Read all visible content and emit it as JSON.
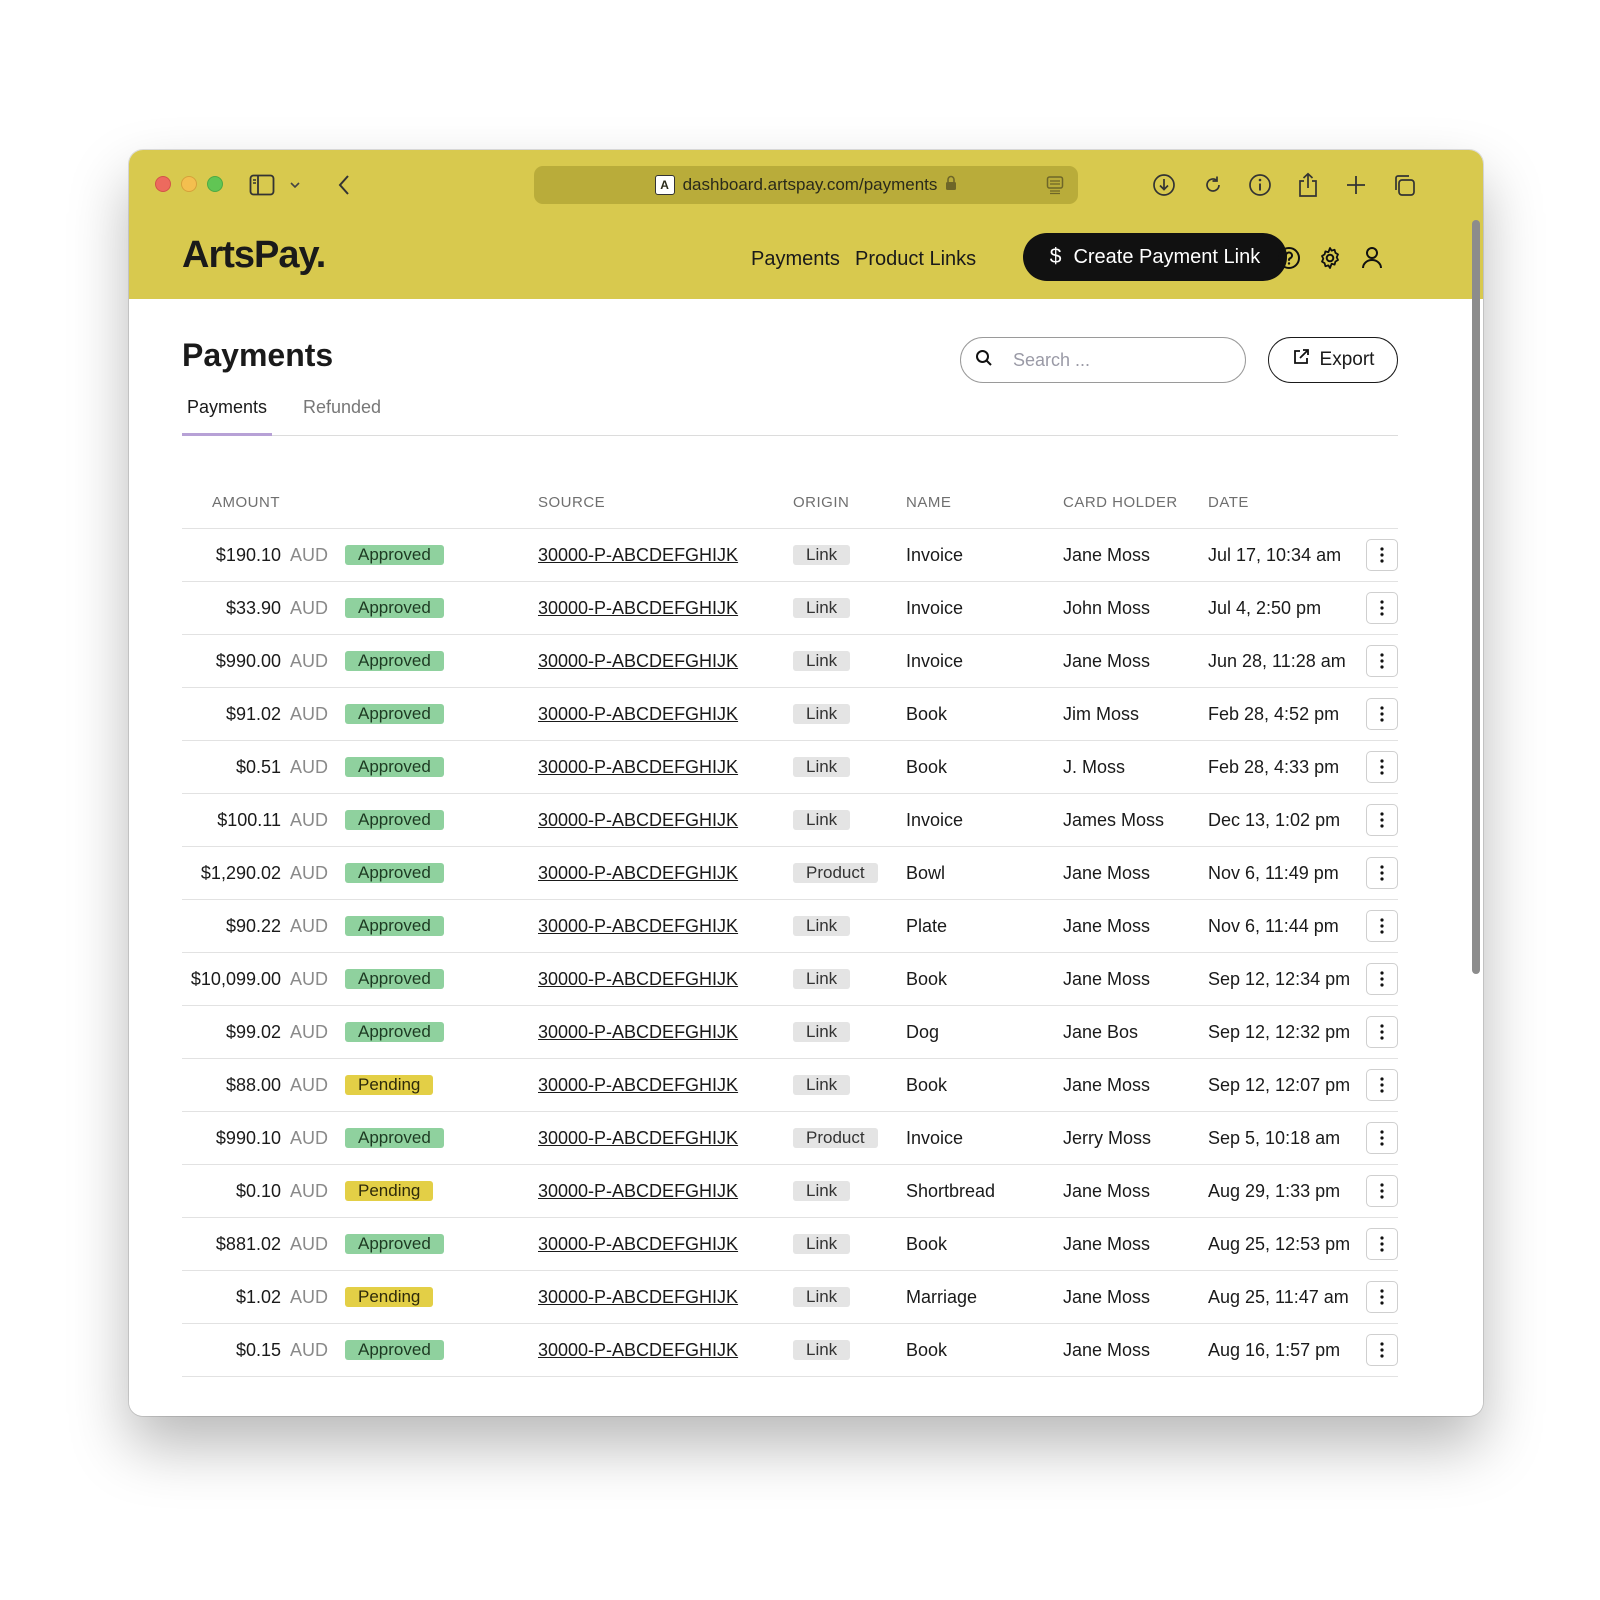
{
  "browser": {
    "url": "dashboard.artspay.com/payments",
    "favicon_letter": "A",
    "chrome_color": "#d8c94e"
  },
  "header": {
    "logo": "ArtsPay.",
    "nav": [
      "Payments",
      "Product Links"
    ],
    "create_button": "Create Payment Link",
    "icons": [
      "help-icon",
      "settings-icon",
      "user-icon"
    ]
  },
  "page": {
    "title": "Payments",
    "search_placeholder": "Search ...",
    "export_label": "Export",
    "tabs": [
      "Payments",
      "Refunded"
    ],
    "active_tab": "Payments"
  },
  "table": {
    "columns": [
      "AMOUNT",
      "SOURCE",
      "ORIGIN",
      "NAME",
      "CARD HOLDER",
      "DATE"
    ],
    "rows": [
      {
        "amount": "$190.10",
        "currency": "AUD",
        "status": "Approved",
        "source": "30000-P-ABCDEFGHIJK",
        "origin": "Link",
        "name": "Invoice",
        "holder": "Jane Moss",
        "date": "Jul 17, 10:34 am"
      },
      {
        "amount": "$33.90",
        "currency": "AUD",
        "status": "Approved",
        "source": "30000-P-ABCDEFGHIJK",
        "origin": "Link",
        "name": "Invoice",
        "holder": "John Moss",
        "date": "Jul 4, 2:50 pm"
      },
      {
        "amount": "$990.00",
        "currency": "AUD",
        "status": "Approved",
        "source": "30000-P-ABCDEFGHIJK",
        "origin": "Link",
        "name": "Invoice",
        "holder": "Jane Moss",
        "date": "Jun 28, 11:28 am"
      },
      {
        "amount": "$91.02",
        "currency": "AUD",
        "status": "Approved",
        "source": "30000-P-ABCDEFGHIJK",
        "origin": "Link",
        "name": "Book",
        "holder": "Jim Moss",
        "date": "Feb 28, 4:52 pm"
      },
      {
        "amount": "$0.51",
        "currency": "AUD",
        "status": "Approved",
        "source": "30000-P-ABCDEFGHIJK",
        "origin": "Link",
        "name": "Book",
        "holder": "J. Moss",
        "date": "Feb 28, 4:33 pm"
      },
      {
        "amount": "$100.11",
        "currency": "AUD",
        "status": "Approved",
        "source": "30000-P-ABCDEFGHIJK",
        "origin": "Link",
        "name": "Invoice",
        "holder": "James Moss",
        "date": "Dec 13, 1:02 pm"
      },
      {
        "amount": "$1,290.02",
        "currency": "AUD",
        "status": "Approved",
        "source": "30000-P-ABCDEFGHIJK",
        "origin": "Product",
        "name": "Bowl",
        "holder": "Jane Moss",
        "date": "Nov 6, 11:49 pm"
      },
      {
        "amount": "$90.22",
        "currency": "AUD",
        "status": "Approved",
        "source": "30000-P-ABCDEFGHIJK",
        "origin": "Link",
        "name": "Plate",
        "holder": "Jane Moss",
        "date": "Nov 6, 11:44 pm"
      },
      {
        "amount": "$10,099.00",
        "currency": "AUD",
        "status": "Approved",
        "source": "30000-P-ABCDEFGHIJK",
        "origin": "Link",
        "name": "Book",
        "holder": "Jane Moss",
        "date": "Sep 12, 12:34 pm"
      },
      {
        "amount": "$99.02",
        "currency": "AUD",
        "status": "Approved",
        "source": "30000-P-ABCDEFGHIJK",
        "origin": "Link",
        "name": "Dog",
        "holder": "Jane Bos",
        "date": "Sep 12, 12:32 pm"
      },
      {
        "amount": "$88.00",
        "currency": "AUD",
        "status": "Pending",
        "source": "30000-P-ABCDEFGHIJK",
        "origin": "Link",
        "name": "Book",
        "holder": "Jane Moss",
        "date": "Sep 12, 12:07 pm"
      },
      {
        "amount": "$990.10",
        "currency": "AUD",
        "status": "Approved",
        "source": "30000-P-ABCDEFGHIJK",
        "origin": "Product",
        "name": "Invoice",
        "holder": "Jerry Moss",
        "date": "Sep 5, 10:18 am"
      },
      {
        "amount": "$0.10",
        "currency": "AUD",
        "status": "Pending",
        "source": "30000-P-ABCDEFGHIJK",
        "origin": "Link",
        "name": "Shortbread",
        "holder": "Jane Moss",
        "date": "Aug 29, 1:33 pm"
      },
      {
        "amount": "$881.02",
        "currency": "AUD",
        "status": "Approved",
        "source": "30000-P-ABCDEFGHIJK",
        "origin": "Link",
        "name": "Book",
        "holder": "Jane Moss",
        "date": "Aug 25, 12:53 pm"
      },
      {
        "amount": "$1.02",
        "currency": "AUD",
        "status": "Pending",
        "source": "30000-P-ABCDEFGHIJK",
        "origin": "Link",
        "name": "Marriage",
        "holder": "Jane Moss",
        "date": "Aug 25, 11:47 am"
      },
      {
        "amount": "$0.15",
        "currency": "AUD",
        "status": "Approved",
        "source": "30000-P-ABCDEFGHIJK",
        "origin": "Link",
        "name": "Book",
        "holder": "Jane Moss",
        "date": "Aug 16, 1:57 pm"
      }
    ]
  },
  "colors": {
    "brand_yellow": "#d8c94e",
    "approved": "#8fd19e",
    "pending": "#e3cf46",
    "tab_underline": "#b7a1d6"
  }
}
